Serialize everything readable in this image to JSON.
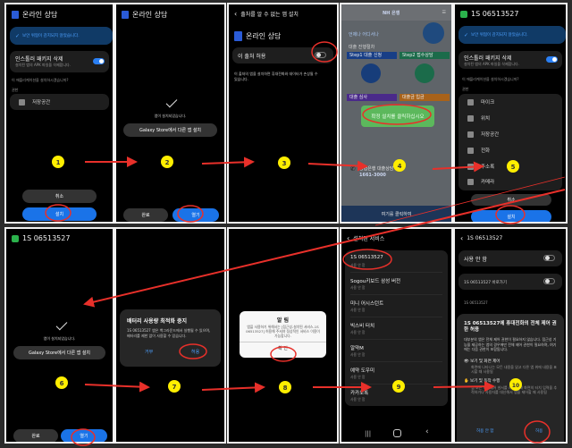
{
  "panels": {
    "p1": {
      "title": "온라인 상담",
      "banner": "보안 위협이 감지되지 않았습니다.",
      "installer_title": "인스톨러 패키지 삭제",
      "installer_sub": "설치된 앱의 APK 파일을 삭제합니다.",
      "question": "이 애플리케이션을 설치하시겠습니까?",
      "perm_label": "권한",
      "perm_storage": "저장공간",
      "cancel": "취소",
      "install": "설치",
      "toggle_on": true
    },
    "p2": {
      "title": "온라인 상담",
      "installed": "앱이 설치되었습니다.",
      "galaxy": "Galaxy Store에서 다른 앱 설치",
      "done": "완료",
      "open": "열기"
    },
    "p3": {
      "back_title": "출처를 알 수 없는 앱 설치",
      "app": "온라인 상담",
      "allow_source": "이 출처 허용",
      "warning": "이 출처의 앱을 설치하면 휴대전화와 데이터가 손상될 수 있습니다.",
      "toggle_on": false
    },
    "p4": {
      "brand": "NH 은행",
      "tagline": "언제나 어디서나",
      "section": "대출 진행절차",
      "step1": "Step1",
      "step1_label": "대출 신청",
      "step2": "Step2",
      "step2_label": "접수상담",
      "step3_label": "대출 심사",
      "step4_label": "대출금 입금",
      "contact": "농협은행 대출상담",
      "phone": "1661-3000",
      "bottom": "여기를 클릭하여",
      "popup": "확정 설치를 클릭하십시오"
    },
    "p5": {
      "title": "1S 06513527",
      "banner": "보안 위협이 감지되지 않았습니다.",
      "installer_title": "인스톨러 패키지 삭제",
      "installer_sub": "설치된 앱의 APK 파일을 삭제합니다.",
      "question": "이 애플리케이션을 설치하시겠습니까?",
      "perm_label": "권한",
      "perms": [
        "마이크",
        "위치",
        "저장공간",
        "전화",
        "주소록",
        "카메라"
      ],
      "cancel": "취소",
      "install": "설치"
    },
    "p6": {
      "title": "1S 06513527",
      "installed": "앱이 설치되었습니다.",
      "galaxy": "Galaxy Store에서 다른 앱 설치",
      "done": "완료",
      "open": "열기"
    },
    "p7": {
      "dialog_title": "배터리 사용량 최적화 중지",
      "dialog_body": "1S 06513527 앱은 백그라운드에서 실행될 수 있으며, 배터리를 제한 없이 사용할 수 있습니다.",
      "deny": "거부",
      "allow": "허용"
    },
    "p8": {
      "dialog_title": "알 림",
      "dialog_body": "앱을 사용하기 위해서는 [접근성-설치된 서비스-1S 06513527] 허용해 주셔야 정상적인 서비스 이용이 가능합니다.",
      "ok": "확 인"
    },
    "p9": {
      "back_title": "설치된 서비스",
      "status": "사용 안 함",
      "services": [
        "1S 06513527",
        "Sogou키보드 삼성 버전",
        "미니 어시스턴트",
        "빅스비 터치",
        "알약M",
        "예약 도우미",
        "카카오톡"
      ]
    },
    "p10": {
      "back_title": "1S 06513527",
      "use": "사용 안 함",
      "shortcut": "1S 06513527 바로가기",
      "app": "1S 06513527",
      "sheet_title": "1S 06513527에 휴대전화의 전체 제어 권한 허용",
      "sheet_body": "대부분의 앱은 전체 제어 권한이 필요하지 않습니다. 접근성 기능을 제공하는 앱의 경우에만 전체 제어 권한이 필요하며, 여기에는 다음 권한이 포함됩니다.",
      "perm1": "보기 및 화면 제어",
      "perm1_desc": "화면에 나타나는 모든 내용을 읽고 다른 앱 위에 내용을 표시할 때 사용됨",
      "perm2": "보기 및 동작 수행",
      "perm2_desc": "앱 또는 하드웨어 센서를 사용할 때 화면의 터치 입력을 추적하거나 사용자를 대신해서 앱을 제어할 때 사용됨",
      "deny": "허용 안 함",
      "allow": "허용"
    }
  },
  "steps": [
    "1",
    "2",
    "3",
    "4",
    "5",
    "6",
    "7",
    "8",
    "9",
    "10"
  ],
  "colors": {
    "annotation": "#e8302a",
    "marker": "#ffee00",
    "accent": "#1a73e8",
    "popup": "#5cb85c"
  }
}
